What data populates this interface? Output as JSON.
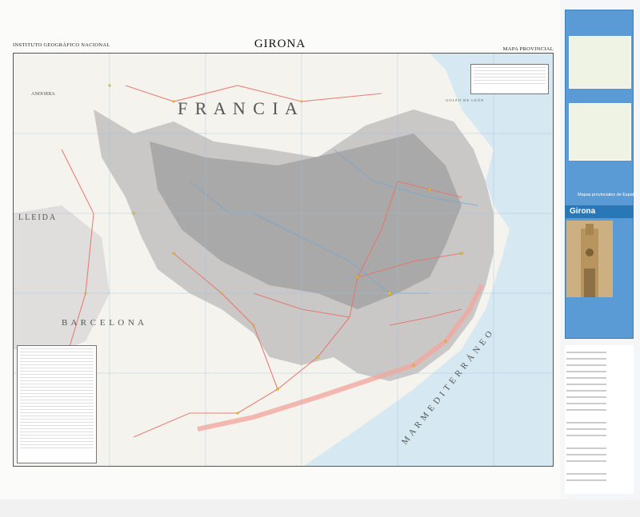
{
  "header": {
    "institute": "INSTITUTO GEOGRÁFICO NACIONAL",
    "title": "GIRONA",
    "series_label": "MAPA PROVINCIAL"
  },
  "map_labels": {
    "country": "F R A N C I A",
    "andorra": "ANDORRA",
    "lleida": "LLEIDA",
    "barcelona": "B A R C E L O N A",
    "sea": "M A R   M E D I T E R R Á N E O",
    "gulf": "GOLFO DE LEÓN"
  },
  "cover": {
    "series": "Mapas provinciales de España",
    "title": "Girona"
  },
  "colors": {
    "land": "#f4f1ea",
    "relief": "#9a9a9a",
    "sea": "#d3e6f1",
    "urban": "#f2a7a0",
    "road": "#e8736a",
    "accent_blue": "#5b9bd5"
  }
}
